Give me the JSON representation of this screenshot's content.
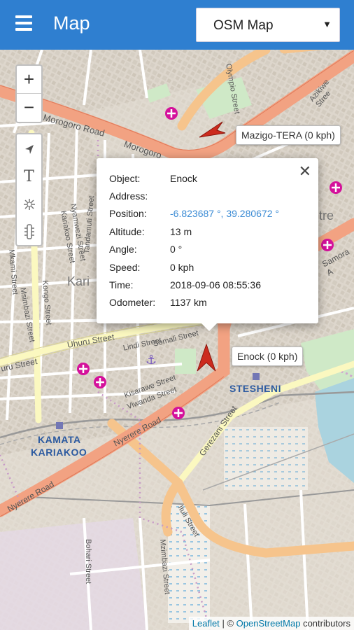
{
  "header": {
    "title": "Map",
    "layer_select": {
      "selected": "OSM Map"
    }
  },
  "map": {
    "zoom_in": "+",
    "zoom_out": "−",
    "tools": {
      "text_tool_glyph": "T"
    },
    "street_labels": [
      "Morogoro Road",
      "Morogoro",
      "Uhuru Street",
      "uru Street",
      "Nyerere Road",
      "Nyerere Road",
      "Gerezani Street",
      "Kariakoo Street",
      "Msimbazi Street",
      "Lindi Street",
      "Somali Street",
      "Kisarawe Street",
      "Viwanda Street",
      "Samora A",
      "Mkunguni Street",
      "Bohari Street",
      "Mzimbazi Street",
      "Olympio Street",
      "Azikiwe Stree",
      "Kongo Street",
      "Tandamuti Street",
      "Mkami Street",
      "Ituli Street",
      "Nyamwezi Street"
    ],
    "place_labels": [
      "Kari",
      "KAMATA",
      "KARIAKOO",
      "STESHENI",
      "tre"
    ],
    "markers": [
      {
        "label": "Mazigo-TERA (0 kph)",
        "color": "#cc2b1e"
      },
      {
        "label": "Enock (0 kph)",
        "color": "#cc2b1e"
      }
    ],
    "popup": {
      "rows": [
        {
          "key": "Object:",
          "value": "Enock"
        },
        {
          "key": "Address:",
          "value": ""
        },
        {
          "key": "Position:",
          "value": "-6.823687 °, 39.280672 °"
        },
        {
          "key": "Altitude:",
          "value": "13 m"
        },
        {
          "key": "Angle:",
          "value": "0 °"
        },
        {
          "key": "Speed:",
          "value": "0 kph"
        },
        {
          "key": "Time:",
          "value": "2018-09-06 08:55:36"
        },
        {
          "key": "Odometer:",
          "value": "1137 km"
        }
      ]
    },
    "attribution": {
      "leaflet": "Leaflet",
      "separator": "|",
      "copyright": "©",
      "osm": "OpenStreetMap",
      "suffix": "contributors"
    }
  },
  "colors": {
    "header": "#2f7fd0",
    "major_road": "#f2a282",
    "secondary_road": "#f6c48c",
    "tertiary_road": "#f5f3b0",
    "water": "#aad3df",
    "park": "#cfe9c7",
    "hospital": "#d4119b"
  }
}
